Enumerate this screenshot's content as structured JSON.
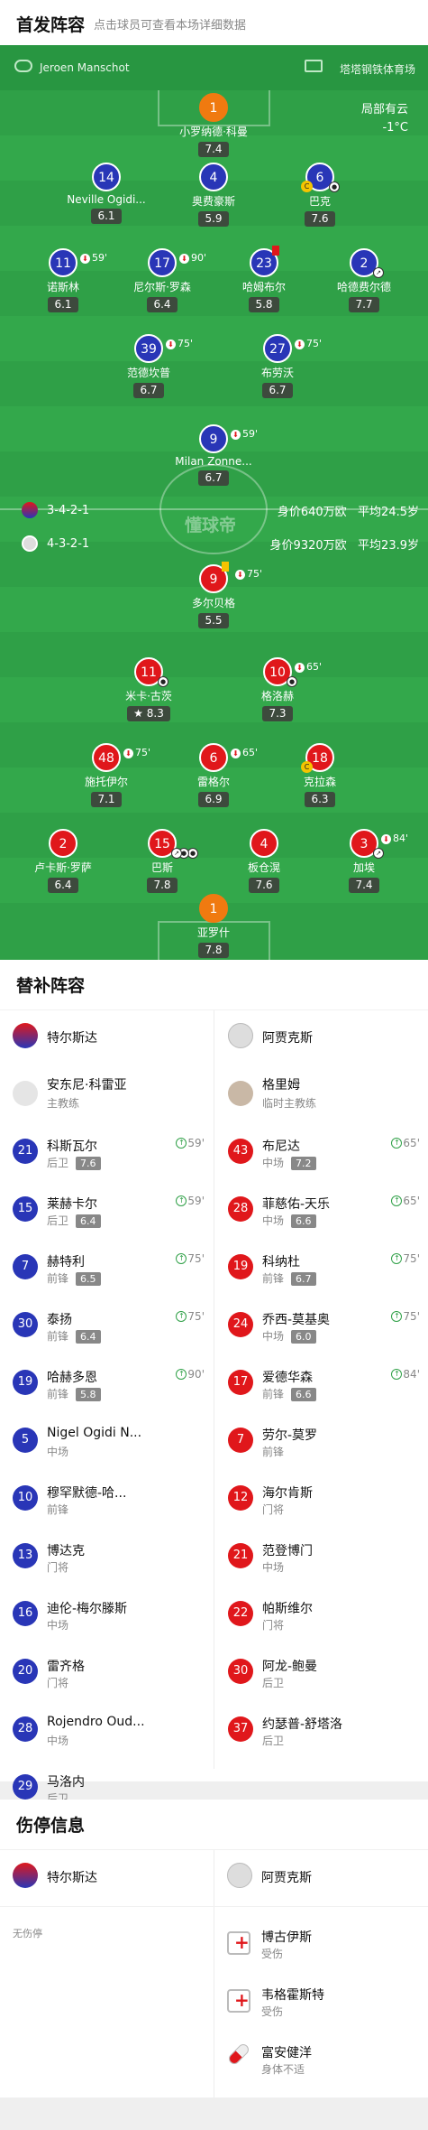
{
  "header": {
    "title": "首发阵容",
    "subtitle": "点击球员可查看本场详细数据"
  },
  "pitch_top": {
    "home_coach": "Jeroen Manschot",
    "venue": "塔塔钢铁体育场",
    "weather_line1": "局部有云",
    "weather_line2": "-1°C",
    "watermark": "懂球帝"
  },
  "home_lineup": {
    "formation": "3-4-2-1",
    "value": "身价640万欧",
    "avg_age": "平均24.5岁",
    "players": [
      {
        "num": "1",
        "name": "小罗纳德·科曼",
        "rating": "7.4"
      },
      {
        "num": "14",
        "name": "Neville Ogidi...",
        "rating": "6.1"
      },
      {
        "num": "4",
        "name": "奥费豪斯",
        "rating": "5.9"
      },
      {
        "num": "6",
        "name": "巴克",
        "rating": "7.6"
      },
      {
        "num": "11",
        "name": "诺斯林",
        "rating": "6.1",
        "sub": "59'"
      },
      {
        "num": "17",
        "name": "尼尔斯·罗森",
        "rating": "6.4",
        "sub": "90'"
      },
      {
        "num": "23",
        "name": "哈姆布尔",
        "rating": "5.8"
      },
      {
        "num": "2",
        "name": "哈德费尔德",
        "rating": "7.7"
      },
      {
        "num": "39",
        "name": "范德坎普",
        "rating": "6.7",
        "sub": "75'"
      },
      {
        "num": "27",
        "name": "布劳沃",
        "rating": "6.7",
        "sub": "75'"
      },
      {
        "num": "9",
        "name": "Milan Zonne...",
        "rating": "6.7",
        "sub": "59'"
      }
    ]
  },
  "away_lineup": {
    "formation": "4-3-2-1",
    "value": "身价9320万欧",
    "avg_age": "平均23.9岁",
    "players": [
      {
        "num": "9",
        "name": "多尔贝格",
        "rating": "5.5",
        "sub": "75'"
      },
      {
        "num": "11",
        "name": "米卡·古茨",
        "rating": "8.3"
      },
      {
        "num": "10",
        "name": "格洛赫",
        "rating": "7.3",
        "sub": "65'"
      },
      {
        "num": "48",
        "name": "施托伊尔",
        "rating": "7.1",
        "sub": "75'"
      },
      {
        "num": "6",
        "name": "雷格尔",
        "rating": "6.9",
        "sub": "65'"
      },
      {
        "num": "18",
        "name": "克拉森",
        "rating": "6.3"
      },
      {
        "num": "2",
        "name": "卢卡斯·罗萨",
        "rating": "6.4"
      },
      {
        "num": "15",
        "name": "巴斯",
        "rating": "7.8"
      },
      {
        "num": "4",
        "name": "板仓滉",
        "rating": "7.6"
      },
      {
        "num": "3",
        "name": "加埃",
        "rating": "7.4",
        "sub": "84'"
      },
      {
        "num": "1",
        "name": "亚罗什",
        "rating": "7.8"
      }
    ]
  },
  "subs": {
    "title": "替补阵容",
    "home_team": "特尔斯达",
    "away_team": "阿贾克斯",
    "home_coach": {
      "name": "安东尼·科雷亚",
      "role": "主教练"
    },
    "away_coach": {
      "name": "格里姆",
      "role": "临时主教练"
    },
    "home": [
      {
        "num": "21",
        "name": "科斯瓦尔",
        "pos": "后卫",
        "rating": "7.6",
        "min": "59'"
      },
      {
        "num": "15",
        "name": "莱赫卡尔",
        "pos": "后卫",
        "rating": "6.4",
        "min": "59'"
      },
      {
        "num": "7",
        "name": "赫特利",
        "pos": "前锋",
        "rating": "6.5",
        "min": "75'"
      },
      {
        "num": "30",
        "name": "泰扬",
        "pos": "前锋",
        "rating": "6.4",
        "min": "75'"
      },
      {
        "num": "19",
        "name": "哈赫多恩",
        "pos": "前锋",
        "rating": "5.8",
        "min": "90'"
      },
      {
        "num": "5",
        "name": "Nigel Ogidi N...",
        "pos": "中场"
      },
      {
        "num": "10",
        "name": "穆罕默德-哈...",
        "pos": "前锋"
      },
      {
        "num": "13",
        "name": "博达克",
        "pos": "门将"
      },
      {
        "num": "16",
        "name": "迪伦-梅尔滕斯",
        "pos": "中场"
      },
      {
        "num": "20",
        "name": "雷齐格",
        "pos": "门将"
      },
      {
        "num": "28",
        "name": "Rojendro Oud...",
        "pos": "中场"
      },
      {
        "num": "29",
        "name": "马洛内",
        "pos": "后卫"
      }
    ],
    "away": [
      {
        "num": "43",
        "name": "布尼达",
        "pos": "中场",
        "rating": "7.2",
        "min": "65'"
      },
      {
        "num": "28",
        "name": "菲慈佑-天乐",
        "pos": "中场",
        "rating": "6.6",
        "min": "65'"
      },
      {
        "num": "19",
        "name": "科纳杜",
        "pos": "前锋",
        "rating": "6.7",
        "min": "75'"
      },
      {
        "num": "24",
        "name": "乔西-莫基奥",
        "pos": "中场",
        "rating": "6.0",
        "min": "75'"
      },
      {
        "num": "17",
        "name": "爱德华森",
        "pos": "前锋",
        "rating": "6.6",
        "min": "84'"
      },
      {
        "num": "7",
        "name": "劳尔-莫罗",
        "pos": "前锋"
      },
      {
        "num": "12",
        "name": "海尔肯斯",
        "pos": "门将"
      },
      {
        "num": "21",
        "name": "范登博门",
        "pos": "中场"
      },
      {
        "num": "22",
        "name": "帕斯维尔",
        "pos": "门将"
      },
      {
        "num": "30",
        "name": "阿龙-鲍曼",
        "pos": "后卫"
      },
      {
        "num": "37",
        "name": "约瑟普-舒塔洛",
        "pos": "后卫"
      }
    ]
  },
  "injuries": {
    "title": "伤停信息",
    "home_team": "特尔斯达",
    "away_team": "阿贾克斯",
    "home_none": "无伤停",
    "away": [
      {
        "name": "博古伊斯",
        "status": "受伤"
      },
      {
        "name": "韦格霍斯特",
        "status": "受伤"
      },
      {
        "name": "富安健洋",
        "status": "身体不适"
      }
    ]
  },
  "colors": {
    "home": "#2936b7",
    "away": "#e0171b",
    "pitch": "#2fa047",
    "keeper": "#f07a10"
  }
}
